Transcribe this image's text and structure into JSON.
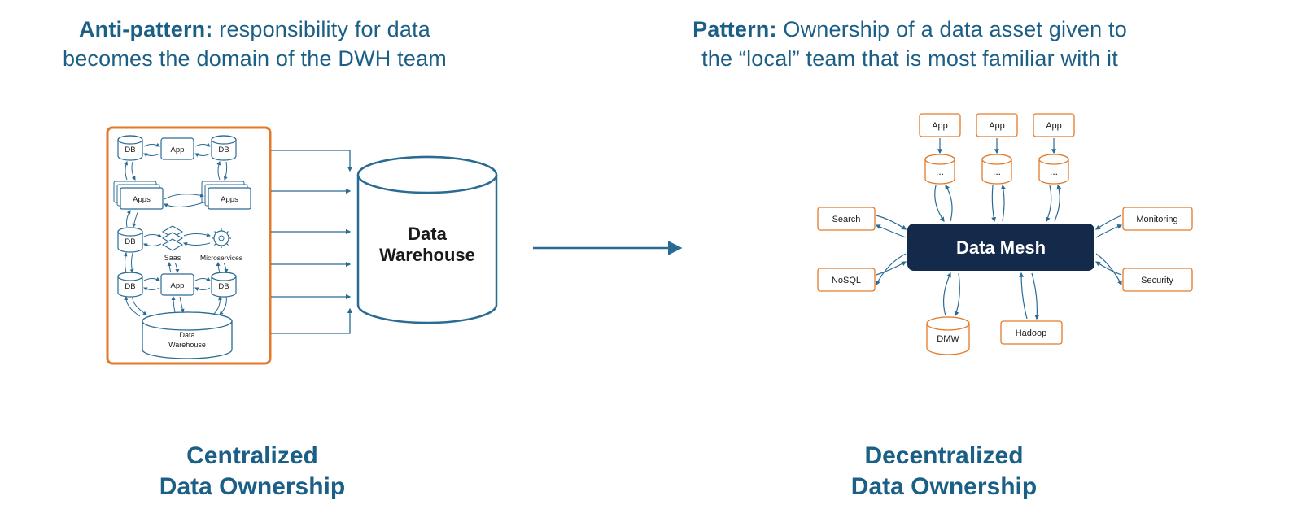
{
  "left": {
    "heading_strong": "Anti-pattern:",
    "heading_rest_line1": " responsibility for data",
    "heading_line2": "becomes the domain of the DWH team",
    "footer_line1": "Centralized",
    "footer_line2": "Data Ownership",
    "nodes": {
      "db1": "DB",
      "app_top": "App",
      "db2": "DB",
      "apps_left": "Apps",
      "apps_right": "Apps",
      "db3": "DB",
      "saas": "Saas",
      "micro": "Microservices",
      "db4": "DB",
      "app_bot": "App",
      "db5": "DB",
      "small_dw_line1": "Data",
      "small_dw_line2": "Warehouse",
      "big_dw_line1": "Data",
      "big_dw_line2": "Warehouse"
    }
  },
  "right": {
    "heading_strong": "Pattern:",
    "heading_rest_line1": " Ownership of a data asset given to",
    "heading_line2": "the “local” team that is most familiar with it",
    "footer_line1": "Decentralized",
    "footer_line2": "Data Ownership",
    "mesh_label": "Data Mesh",
    "nodes": {
      "app1": "App",
      "app2": "App",
      "app3": "App",
      "dots": "...",
      "search": "Search",
      "nosql": "NoSQL",
      "dmw": "DMW",
      "hadoop": "Hadoop",
      "monitoring": "Monitoring",
      "security": "Security"
    }
  },
  "colors": {
    "text": "#1c5f86",
    "blue_line": "#2a6b94",
    "orange": "#e37a2a",
    "mesh_fill": "#142a4a",
    "mesh_text": "#ffffff",
    "node_text": "#1a1a1a"
  }
}
